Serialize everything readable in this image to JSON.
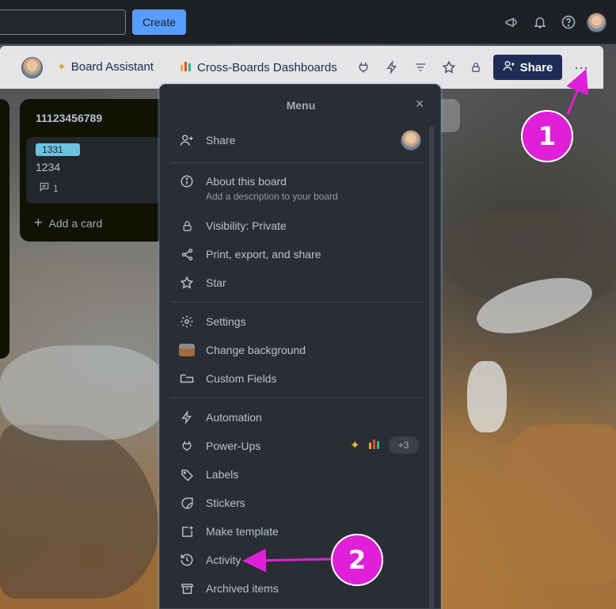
{
  "topbar": {
    "create_label": "Create",
    "icons": [
      "megaphone-icon",
      "bell-icon",
      "help-icon"
    ]
  },
  "boardbar": {
    "board_assistant": "Board Assistant",
    "dashboards": "Cross-Boards Dashboards",
    "share_label": "Share",
    "more_label": "···"
  },
  "list": {
    "title": "11123456789",
    "card": {
      "label": "1331",
      "title": "1234",
      "comments": "1"
    },
    "add_card": "Add a card"
  },
  "menu": {
    "title": "Menu",
    "close": "×",
    "share": "Share",
    "about": {
      "label": "About this board",
      "sub": "Add a description to your board"
    },
    "visibility": "Visibility: Private",
    "print": "Print, export, and share",
    "star": "Star",
    "settings": "Settings",
    "change_bg": "Change background",
    "custom_fields": "Custom Fields",
    "automation": "Automation",
    "powerups": "Power-Ups",
    "powerups_more": "+3",
    "labels": "Labels",
    "stickers": "Stickers",
    "make_template": "Make template",
    "activity": "Activity",
    "archived": "Archived items"
  },
  "annotations": {
    "step1": "1",
    "step2": "2",
    "color": "#e020d8"
  }
}
